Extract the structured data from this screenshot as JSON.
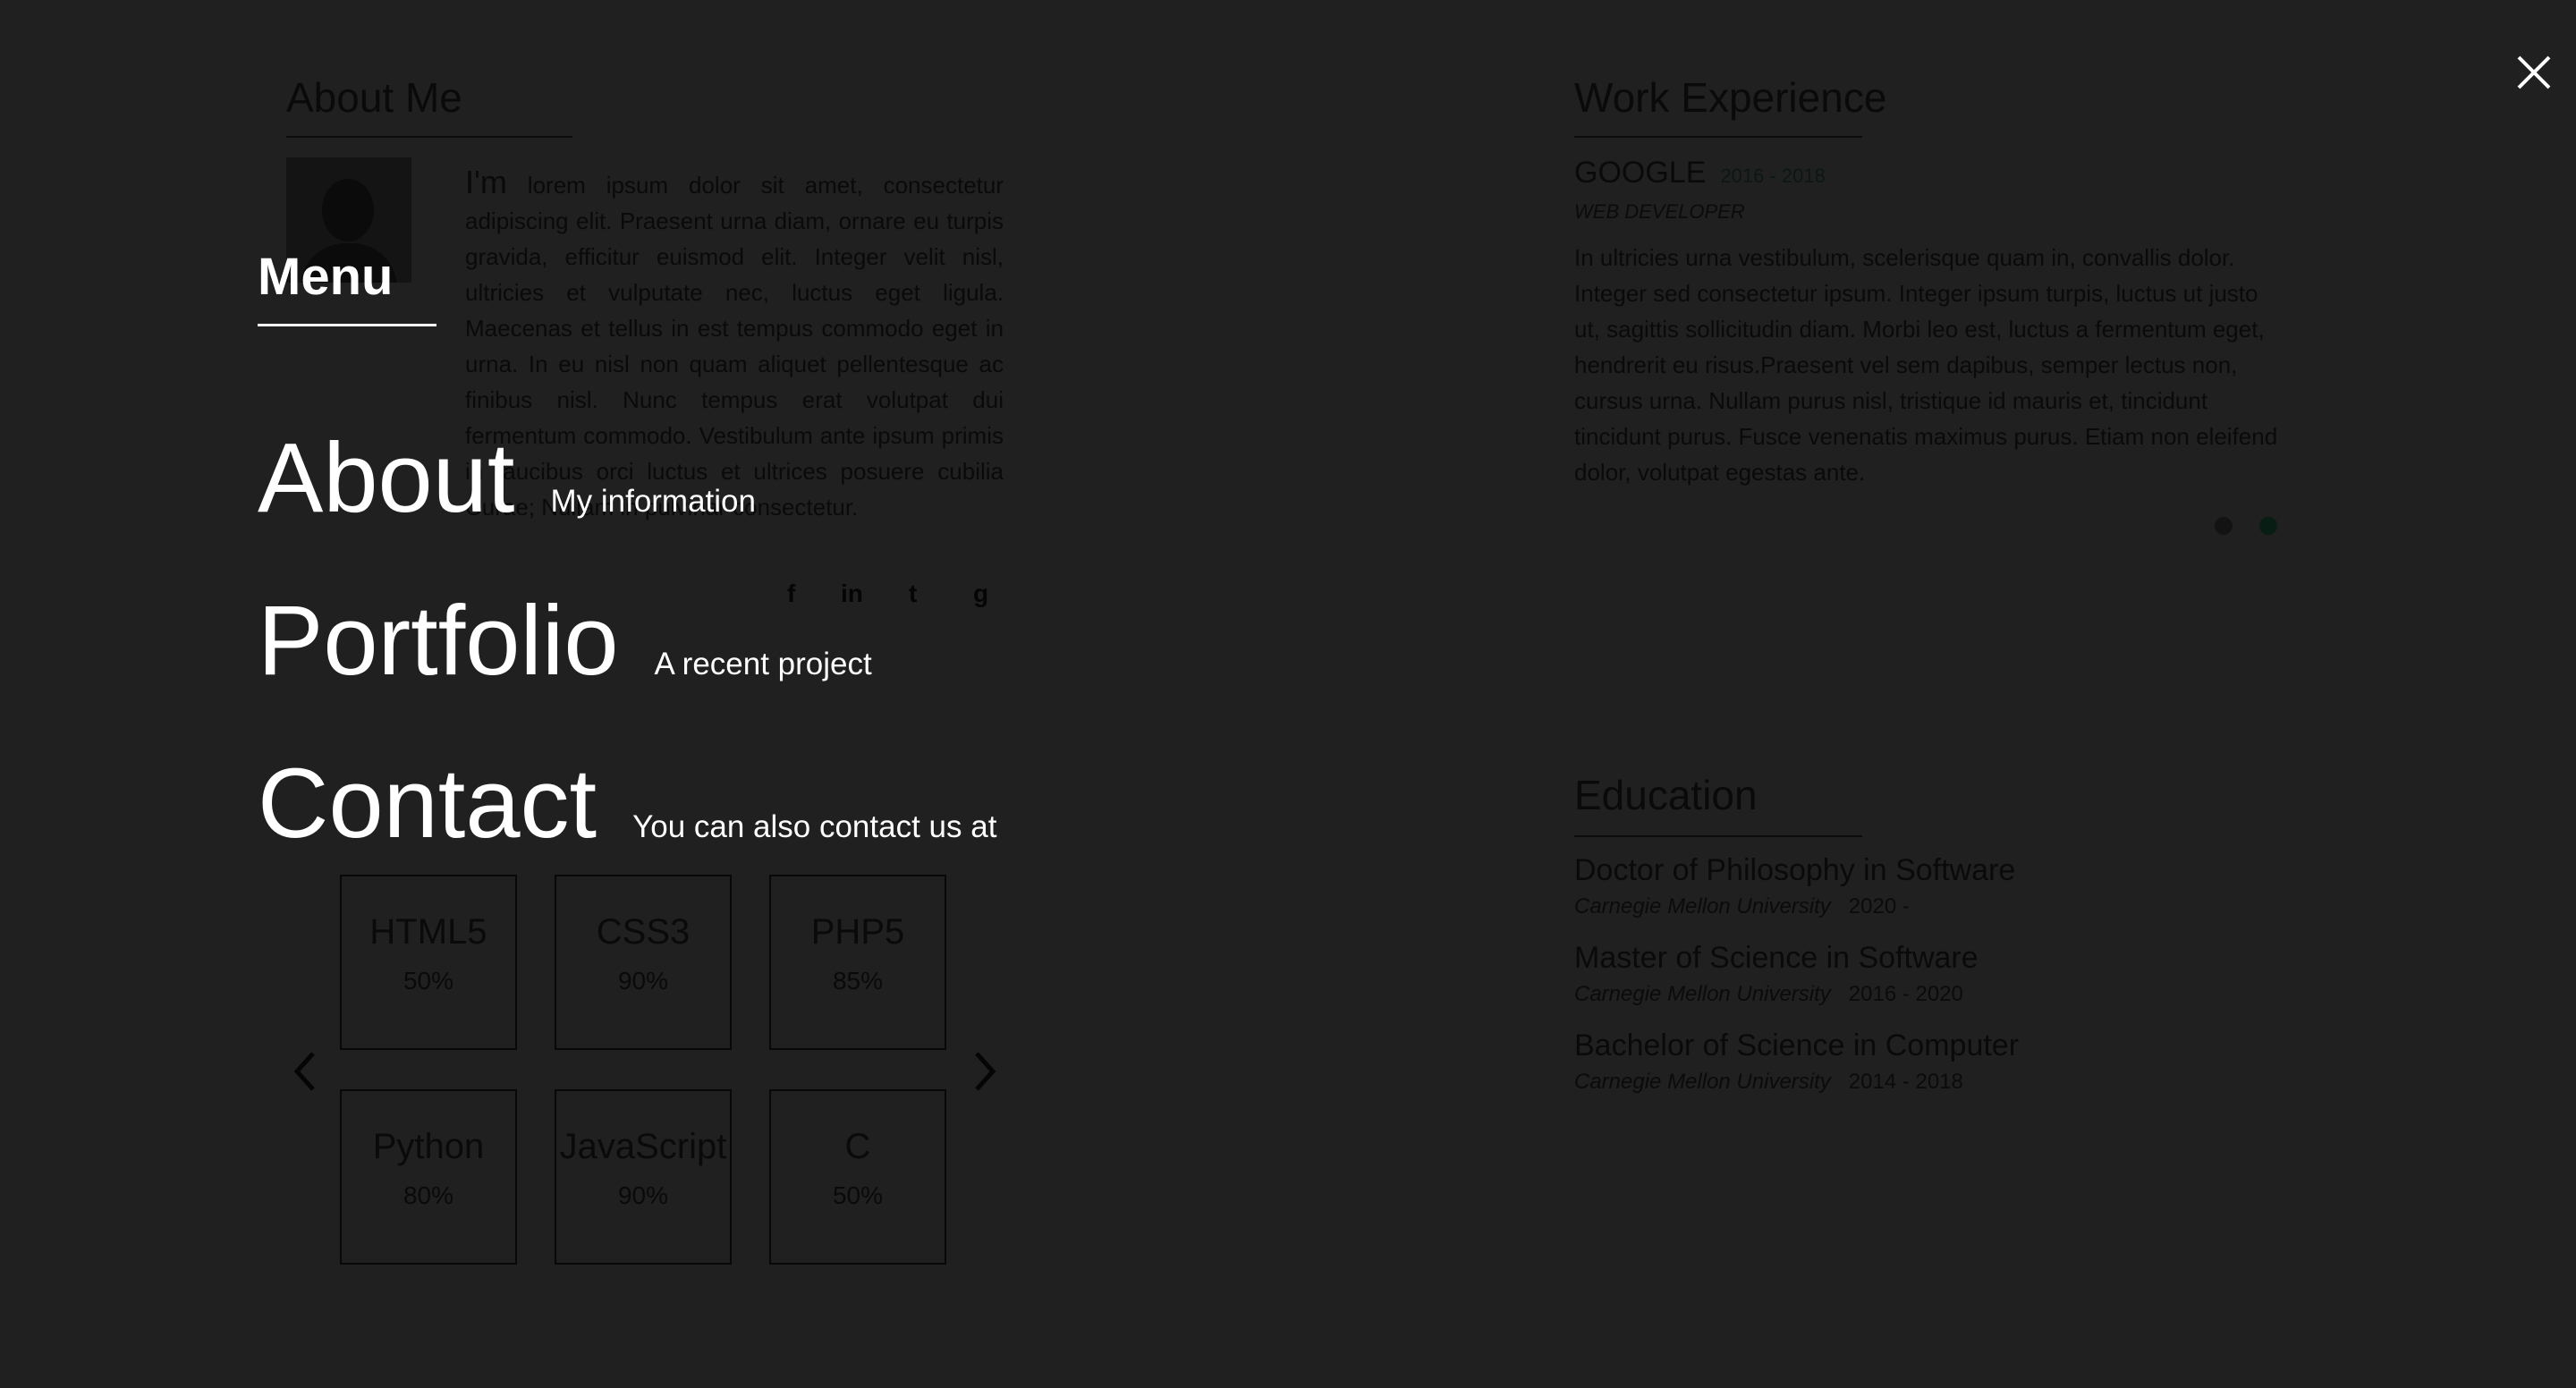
{
  "about": {
    "title": "About Me",
    "intro_word": "I'm",
    "bio": "lorem ipsum dolor sit amet, consectetur adipiscing elit. Praesent urna diam, ornare eu turpis gravida, efficitur euismod elit. Integer velit nisl, ultricies et vulputate nec, luctus eget ligula. Maecenas et tellus in est tempus commodo eget in urna. In eu nisl non quam aliquet pellentesque ac finibus nisl. Nunc tempus erat volutpat dui fermentum commodo. Vestibulum ante ipsum primis in faucibus orci luctus et ultrices posuere cubilia Curae; Nullam in pulvinar consectetur.",
    "social": [
      {
        "icon": "facebook-icon",
        "glyph": "f"
      },
      {
        "icon": "linkedin-icon",
        "glyph": "in"
      },
      {
        "icon": "twitter-icon",
        "glyph": "t"
      },
      {
        "icon": "github-icon",
        "glyph": "g"
      }
    ]
  },
  "work": {
    "title": "Work Experience",
    "company": "GOOGLE",
    "years": "2016 - 2018",
    "role": "WEB DEVELOPER",
    "description": "In ultricies urna vestibulum, scelerisque quam in, convallis dolor. Integer sed consectetur ipsum. Integer ipsum turpis, luctus ut justo ut, sagittis sollicitudin diam. Morbi leo est, luctus a fermentum eget, hendrerit eu risus.Praesent vel sem dapibus, semper lectus non, cursus urna. Nullam purus nisl, tristique id mauris et, tincidunt tincidunt purus. Fusce venenatis maximus purus. Etiam non eleifend dolor, volutpat egestas ante.",
    "pager_active": 2,
    "pager_total": 2
  },
  "education": {
    "title": "Education",
    "items": [
      {
        "degree": "Doctor of Philosophy in Software",
        "school": "Carnegie Mellon University",
        "years": "2020 -"
      },
      {
        "degree": "Master of Science in Software",
        "school": "Carnegie Mellon University",
        "years": "2016 - 2020"
      },
      {
        "degree": "Bachelor of Science in Computer",
        "school": "Carnegie Mellon University",
        "years": "2014 - 2018"
      }
    ]
  },
  "skills": [
    {
      "name": "HTML5",
      "percent": "50%"
    },
    {
      "name": "CSS3",
      "percent": "90%"
    },
    {
      "name": "PHP5",
      "percent": "85%"
    },
    {
      "name": "Python",
      "percent": "80%"
    },
    {
      "name": "JavaScript",
      "percent": "90%"
    },
    {
      "name": "C",
      "percent": "50%"
    }
  ],
  "menu": {
    "title": "Menu",
    "items": [
      {
        "label": "About",
        "sub": "My information"
      },
      {
        "label": "Portfolio",
        "sub": "A recent project"
      },
      {
        "label": "Contact",
        "sub": "You can also contact us at"
      }
    ]
  },
  "colors": {
    "overlay_bg": "#1f1f1f",
    "menu_text": "#ffffff",
    "accent_dim": "#0b1812"
  }
}
